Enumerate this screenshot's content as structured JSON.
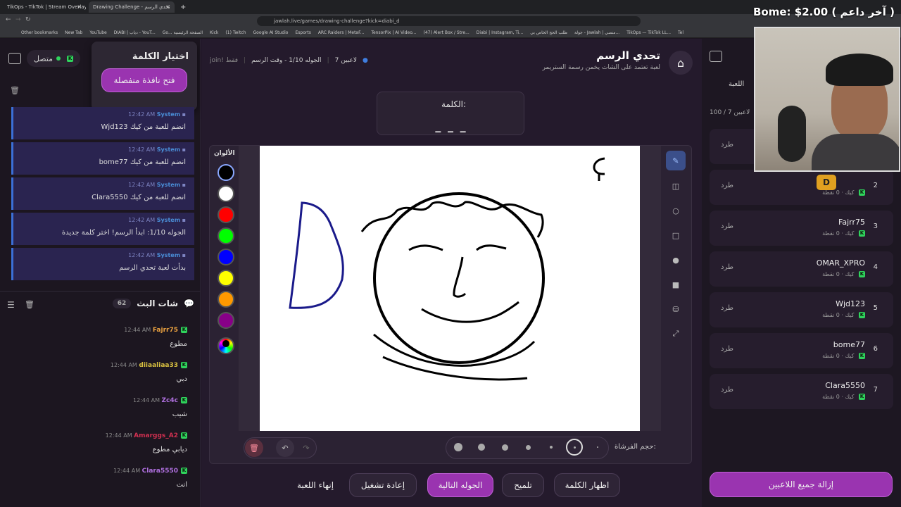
{
  "browser": {
    "tabs": [
      {
        "label": "TikOps - TikTok | Stream Overlays"
      },
      {
        "label": "Drawing Challenge - تحدي الرسم"
      }
    ],
    "url": "jawlah.live/games/drawing-challenge?kick=diabi_d",
    "bookmarks": [
      "Other bookmarks",
      "New Tab",
      "YouTube",
      "DIABI | دياب - YouT...",
      "Go... الصفحة الرئيسية",
      "Kick",
      "(1) Twitch",
      "Google AI Studio",
      "Esports",
      "ARC Raiders | MetaF...",
      "TensorPix | AI Video...",
      "(47) Alert Box / Stre...",
      "Diabi | Instagram, Ti...",
      "طلب الحج الخاص بي",
      "جولة - Jawlah | منصي...",
      "TikOps — TikTok LL...",
      "Tel"
    ]
  },
  "stream_overlay": {
    "text": "Bome: $2.00 ( آخر داعم )",
    "badge": "D"
  },
  "left": {
    "word_box_title": "اختيار الكلمة",
    "open_window_button": "فتح نافذة منفصلة",
    "status": "متصل",
    "system_messages": [
      {
        "sender": "System",
        "time": "12:42 AM",
        "text": "Wjd123 انضم للعبة من كيك"
      },
      {
        "sender": "System",
        "time": "12:42 AM",
        "text": "bome77 انضم للعبة من كيك"
      },
      {
        "sender": "System",
        "time": "12:42 AM",
        "text": "Clara5550 انضم للعبة من كيك"
      },
      {
        "sender": "System",
        "time": "12:42 AM",
        "text": "الجوله 1/10: ابدأ الرسم! اختر كلمة جديدة"
      },
      {
        "sender": "System",
        "time": "12:42 AM",
        "text": "بدأت لعبة تحدي الرسم"
      }
    ],
    "stream_chat_title": "شات البث",
    "stream_chat_count": "62",
    "chat": [
      {
        "user": "Fajrr75",
        "time": "12:44 AM",
        "msg": "مطوع",
        "color": "#e8a040"
      },
      {
        "user": "diiaaliaa33",
        "time": "12:44 AM",
        "msg": "دبي",
        "color": "#d8c040"
      },
      {
        "user": "Zc4c",
        "time": "12:44 AM",
        "msg": "شيب",
        "color": "#b070e0"
      },
      {
        "user": "Amarggs_A2",
        "time": "12:44 AM",
        "msg": "ديابي مطوع",
        "color": "#d03050"
      },
      {
        "user": "Clara5550",
        "time": "12:44 AM",
        "msg": "انت",
        "color": "#b070e0"
      }
    ]
  },
  "game": {
    "title": "تحدي الرسم",
    "subtitle": "لعبة تعتمد على الشات يخمن رسمة الستريمر",
    "players_info": "7 لاعبين",
    "round_info": "الجوله 1/10 - وقت الرسم",
    "join_info": "join! فقط",
    "word_label": "الكلمة:",
    "word_mask": "_ _ _",
    "colors_label": "الألوان",
    "colors": [
      "#000000",
      "#ffffff",
      "#ff0000",
      "#00ff00",
      "#0000ff",
      "#ffff00",
      "#ff9900",
      "#880088"
    ],
    "brush_size_label": "حجم الفرشاة:",
    "buttons": {
      "end": "إنهاء اللعبة",
      "restart": "إعادة تشغيل",
      "next_round": "الجوله التالية",
      "hint": "تلميح",
      "show_word": "اظهار الكلمة"
    }
  },
  "right": {
    "players_header": "اللعبة",
    "players_count": "100 / 7 لاعبين",
    "kick_label": "طرد",
    "remove_all": "إزالة جميع اللاعبين",
    "players": [
      {
        "rank": "2",
        "name": "",
        "sub": "كيك · 0 نقطة"
      },
      {
        "rank": "3",
        "name": "Fajrr75",
        "sub": "كيك · 0 نقطة"
      },
      {
        "rank": "4",
        "name": "OMAR_XPRO",
        "sub": "كيك · 0 نقطة"
      },
      {
        "rank": "5",
        "name": "Wjd123",
        "sub": "كيك · 0 نقطة"
      },
      {
        "rank": "6",
        "name": "bome77",
        "sub": "كيك · 0 نقطة"
      },
      {
        "rank": "7",
        "name": "Clara5550",
        "sub": "كيك · 0 نقطة"
      }
    ]
  }
}
